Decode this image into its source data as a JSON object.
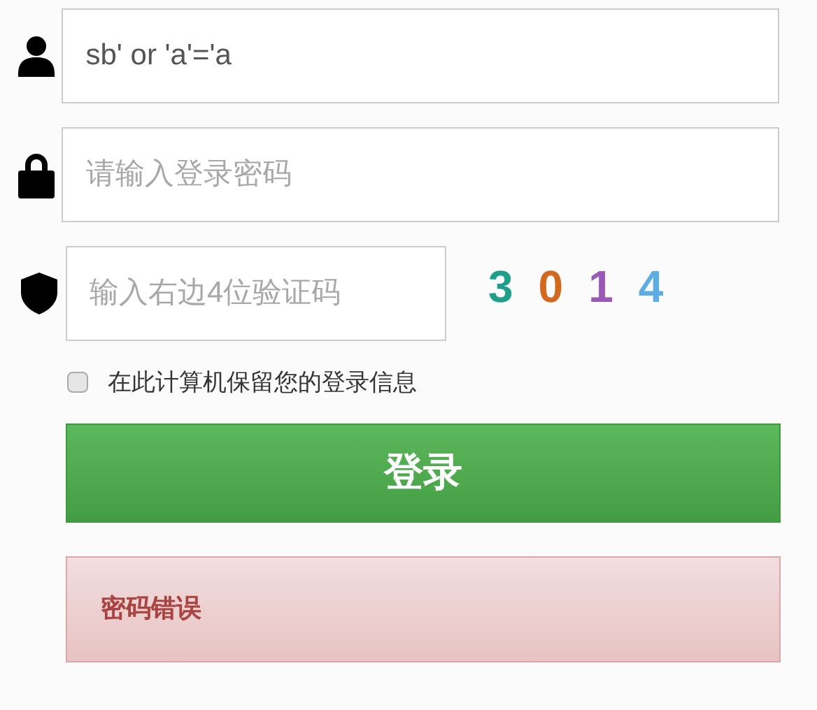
{
  "fields": [
    {
      "value": "sb' or 'a'='a"
    },
    {
      "placeholder": "请输入登录密码"
    }
  ],
  "captcha": {
    "placeholder": "输入右边4位验证码",
    "digits": [
      {
        "text": "3",
        "color": "#1f9e8a"
      },
      {
        "text": "0",
        "color": "#d2691e"
      },
      {
        "text": "1",
        "color": "#9b59b6"
      },
      {
        "text": "4",
        "color": "#5dade2"
      }
    ]
  },
  "remember": {
    "label": "在此计算机保留您的登录信息",
    "checked": false
  },
  "login_button": "登录",
  "alert": "密码错误"
}
